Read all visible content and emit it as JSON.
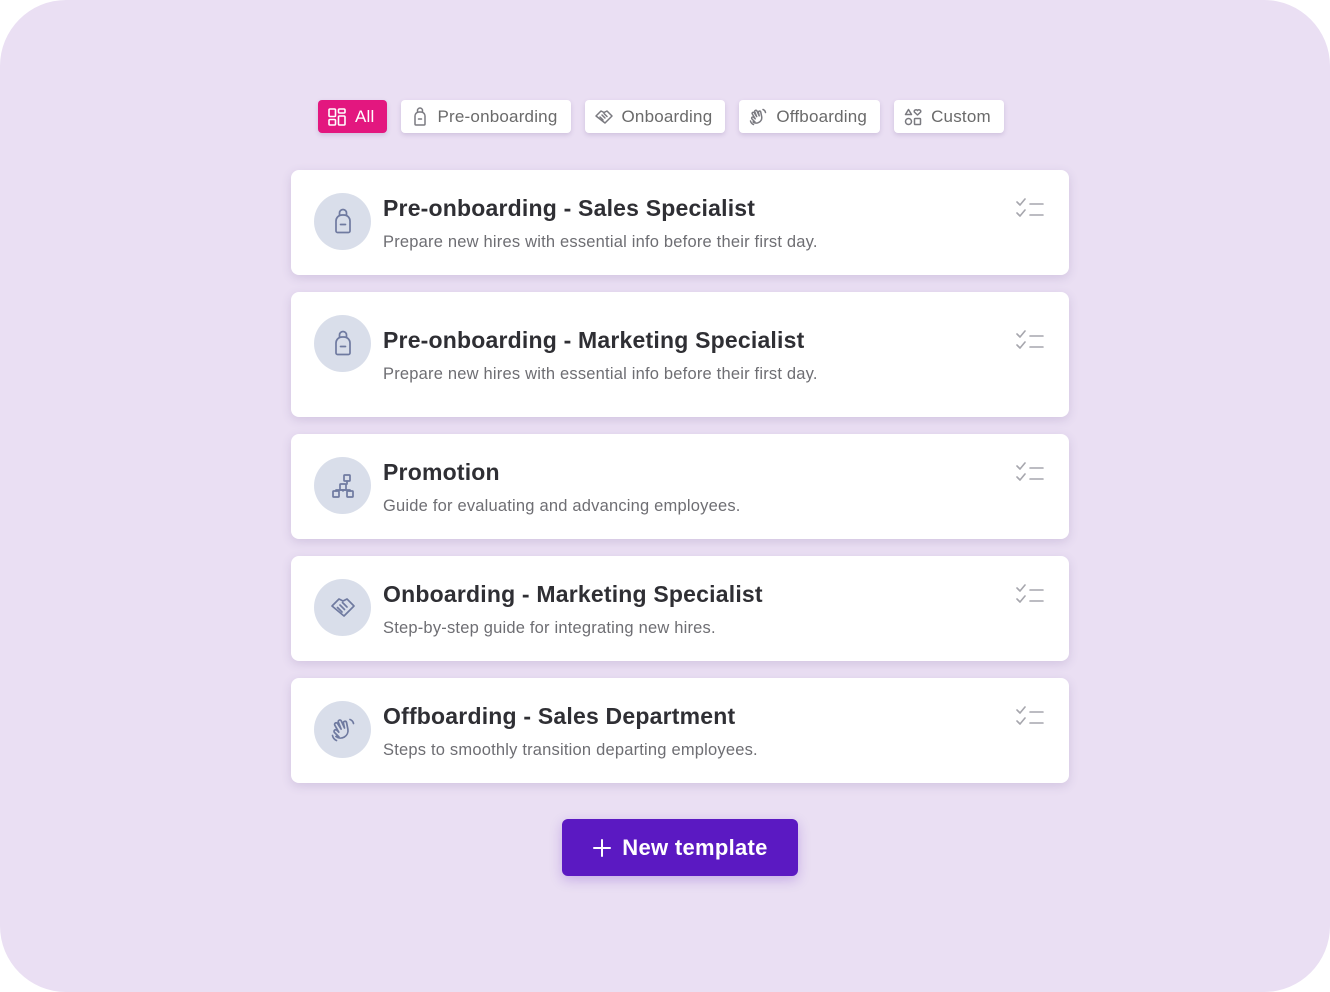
{
  "filters": [
    {
      "label": "All",
      "icon": "grid-icon",
      "active": true
    },
    {
      "label": "Pre-onboarding",
      "icon": "backpack-icon",
      "active": false
    },
    {
      "label": "Onboarding",
      "icon": "handshake-icon",
      "active": false
    },
    {
      "label": "Offboarding",
      "icon": "wave-hand-icon",
      "active": false
    },
    {
      "label": "Custom",
      "icon": "shapes-icon",
      "active": false
    }
  ],
  "templates": [
    {
      "title": "Pre-onboarding - Sales Specialist",
      "description": "Prepare new hires with essential info before their first day.",
      "icon": "backpack-icon"
    },
    {
      "title": "Pre-onboarding - Marketing Specialist",
      "description": "Prepare new hires with essential info before their first day.",
      "icon": "backpack-icon"
    },
    {
      "title": "Promotion",
      "description": "Guide for evaluating and advancing employees.",
      "icon": "org-chart-icon"
    },
    {
      "title": "Onboarding - Marketing Specialist",
      "description": "Step-by-step guide for integrating new hires.",
      "icon": "handshake-icon"
    },
    {
      "title": "Offboarding - Sales Department",
      "description": "Steps to smoothly transition departing employees.",
      "icon": "wave-hand-icon"
    }
  ],
  "new_template_button": {
    "label": "New template",
    "icon": "plus-icon"
  },
  "colors": {
    "background": "#eadff3",
    "active_chip": "#e3177f",
    "primary_button": "#5b19c2",
    "avatar_bg": "#d9deea",
    "icon_stroke": "#6f7aa0"
  }
}
